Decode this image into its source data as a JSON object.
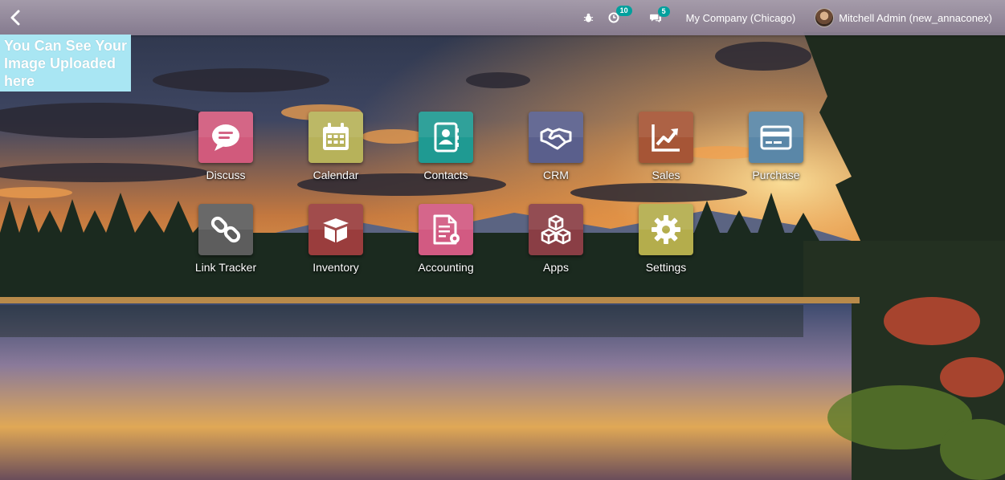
{
  "navbar": {
    "back_icon": "chevron-left-icon",
    "debug_icon": "bug-icon",
    "activities": {
      "icon": "clock-icon",
      "count": "10"
    },
    "messages": {
      "icon": "comments-icon",
      "count": "5"
    },
    "company": "My Company (Chicago)",
    "user": "Mitchell Admin (new_annaconex)",
    "badge_color": "#00a09d"
  },
  "upload_note": "You Can See Your Image Uploaded here",
  "apps": [
    {
      "label": "Discuss",
      "icon": "chat-bubble-icon",
      "color": "#d15a7c"
    },
    {
      "label": "Calendar",
      "icon": "calendar-icon",
      "color": "#b7b25a"
    },
    {
      "label": "Contacts",
      "icon": "address-book-icon",
      "color": "#1f9a92"
    },
    {
      "label": "CRM",
      "icon": "handshake-icon",
      "color": "#5a5f8c"
    },
    {
      "label": "Sales",
      "icon": "trend-chart-icon",
      "color": "#a65536"
    },
    {
      "label": "Purchase",
      "icon": "credit-card-icon",
      "color": "#5a87a8"
    },
    {
      "label": "Link Tracker",
      "icon": "link-icon",
      "color": "#5d5d5d"
    },
    {
      "label": "Inventory",
      "icon": "box-icon",
      "color": "#9a3d3d"
    },
    {
      "label": "Accounting",
      "icon": "invoice-gear-icon",
      "color": "#d25a82"
    },
    {
      "label": "Apps",
      "icon": "cubes-icon",
      "color": "#8a3e45"
    },
    {
      "label": "Settings",
      "icon": "gear-icon",
      "color": "#b4ad4c"
    }
  ]
}
